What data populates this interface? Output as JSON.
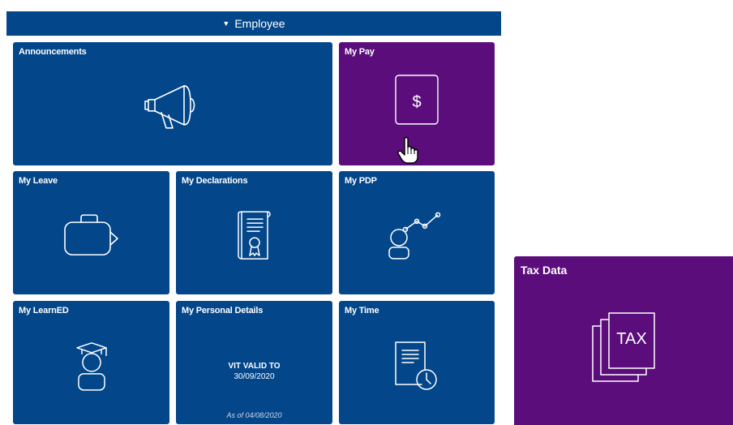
{
  "header": {
    "title": "Employee",
    "caret_icon": "triangle-down-icon"
  },
  "tiles": {
    "announcements": {
      "title": "Announcements",
      "icon": "megaphone-icon"
    },
    "my_pay": {
      "title": "My Pay",
      "icon": "dollar-icon",
      "symbol": "$"
    },
    "my_leave": {
      "title": "My Leave",
      "icon": "suitcase-icon"
    },
    "my_declarations": {
      "title": "My Declarations",
      "icon": "certificate-icon"
    },
    "my_pdp": {
      "title": "My PDP",
      "icon": "person-growth-icon"
    },
    "my_learned": {
      "title": "My LearnED",
      "icon": "graduate-icon"
    },
    "my_personal_details": {
      "title": "My Personal Details",
      "status_line1": "VIT VALID TO",
      "status_line2": "30/09/2020",
      "as_of": "As of 04/08/2020"
    },
    "my_time": {
      "title": "My Time",
      "icon": "document-clock-icon"
    },
    "tax_data": {
      "title": "Tax Data",
      "icon": "tax-document-icon",
      "icon_text": "TAX"
    }
  },
  "colors": {
    "blue": "#03468a",
    "purple": "#5b0e7b",
    "white": "#ffffff"
  }
}
